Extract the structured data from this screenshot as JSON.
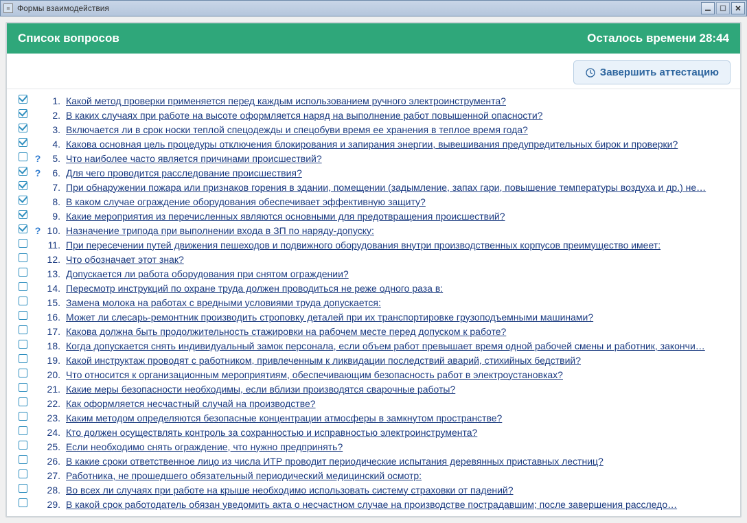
{
  "window": {
    "title": "Формы взаимодействия"
  },
  "header": {
    "title": "Список вопросов",
    "time_label": "Осталось времени",
    "time_value": "28:44"
  },
  "toolbar": {
    "finish_label": "Завершить аттестацию"
  },
  "questions": [
    {
      "n": 1,
      "checked": true,
      "hint": false,
      "text": "Какой метод проверки применяется перед каждым использованием ручного электроинструмента?"
    },
    {
      "n": 2,
      "checked": true,
      "hint": false,
      "text": "В каких случаях при работе на высоте оформляется наряд на выполнение работ повышенной опасности?"
    },
    {
      "n": 3,
      "checked": true,
      "hint": false,
      "text": "Включается ли в срок носки теплой спецодежды и спецобуви время ее хранения в теплое время года?"
    },
    {
      "n": 4,
      "checked": true,
      "hint": false,
      "text": "Какова основная цель процедуры отключения блокирования и запирания энергии, вывешивания предупредительных бирок и проверки?"
    },
    {
      "n": 5,
      "checked": false,
      "hint": true,
      "text": "Что наиболее часто является причинами происшествий?"
    },
    {
      "n": 6,
      "checked": true,
      "hint": true,
      "text": "Для чего проводится расследование происшествия?"
    },
    {
      "n": 7,
      "checked": true,
      "hint": false,
      "text": "При обнаружении пожара или признаков горения в здании, помещении (задымление, запах гари, повышение температуры воздуха и др.) не…"
    },
    {
      "n": 8,
      "checked": true,
      "hint": false,
      "text": "В каком случае ограждение оборудования обеспечивает эффективную защиту?"
    },
    {
      "n": 9,
      "checked": true,
      "hint": false,
      "text": "Какие мероприятия из перечисленных являются основными для предотвращения происшествий?"
    },
    {
      "n": 10,
      "checked": true,
      "hint": true,
      "text": "Назначение трипода при выполнении входа в ЗП по наряду-допуску:"
    },
    {
      "n": 11,
      "checked": false,
      "hint": false,
      "text": "При пересечении путей движения пешеходов и подвижного оборудования внутри производственных корпусов преимущество имеет:"
    },
    {
      "n": 12,
      "checked": false,
      "hint": false,
      "text": "Что обозначает этот знак?"
    },
    {
      "n": 13,
      "checked": false,
      "hint": false,
      "text": "Допускается ли работа оборудования при снятом ограждении?"
    },
    {
      "n": 14,
      "checked": false,
      "hint": false,
      "text": "Пересмотр инструкций по охране труда должен проводиться не реже одного раза в:"
    },
    {
      "n": 15,
      "checked": false,
      "hint": false,
      "text": "Замена молока на работах с вредными условиями труда допускается:"
    },
    {
      "n": 16,
      "checked": false,
      "hint": false,
      "text": "Может ли слесарь-ремонтник производить строповку деталей при их транспортировке грузоподъемными машинами?"
    },
    {
      "n": 17,
      "checked": false,
      "hint": false,
      "text": "Какова должна быть продолжительность стажировки на рабочем месте перед допуском к работе?"
    },
    {
      "n": 18,
      "checked": false,
      "hint": false,
      "text": "Когда допускается снять индивидуальный замок персонала, если объем работ превышает время одной рабочей смены и работник, закончи…"
    },
    {
      "n": 19,
      "checked": false,
      "hint": false,
      "text": "Какой инструктаж проводят с работником, привлеченным к ликвидации последствий аварий, стихийных бедствий?"
    },
    {
      "n": 20,
      "checked": false,
      "hint": false,
      "text": "Что относится к организационным мероприятиям, обеспечивающим безопасность работ в электроустановках?"
    },
    {
      "n": 21,
      "checked": false,
      "hint": false,
      "text": "Какие меры безопасности необходимы, если вблизи производятся сварочные работы?"
    },
    {
      "n": 22,
      "checked": false,
      "hint": false,
      "text": "Как оформляется несчастный случай на производстве?"
    },
    {
      "n": 23,
      "checked": false,
      "hint": false,
      "text": "Каким методом определяются безопасные концентрации атмосферы в замкнутом пространстве?"
    },
    {
      "n": 24,
      "checked": false,
      "hint": false,
      "text": "Кто должен осуществлять контроль за сохранностью и исправностью электроинструмента?"
    },
    {
      "n": 25,
      "checked": false,
      "hint": false,
      "text": "Если необходимо снять ограждение, что нужно предпринять?"
    },
    {
      "n": 26,
      "checked": false,
      "hint": false,
      "text": "В какие сроки ответственное лицо из числа ИТР проводит периодические испытания деревянных приставных лестниц?"
    },
    {
      "n": 27,
      "checked": false,
      "hint": false,
      "text": "Работника, не прошедшего обязательный периодический медицинский осмотр:"
    },
    {
      "n": 28,
      "checked": false,
      "hint": false,
      "text": "Во всех ли случаях при работе на крыше необходимо использовать систему страховки от падений?"
    },
    {
      "n": 29,
      "checked": false,
      "hint": false,
      "text": "В какой срок работодатель обязан уведомить акта о несчастном случае на производстве пострадавшим; после завершения расследо…"
    }
  ]
}
